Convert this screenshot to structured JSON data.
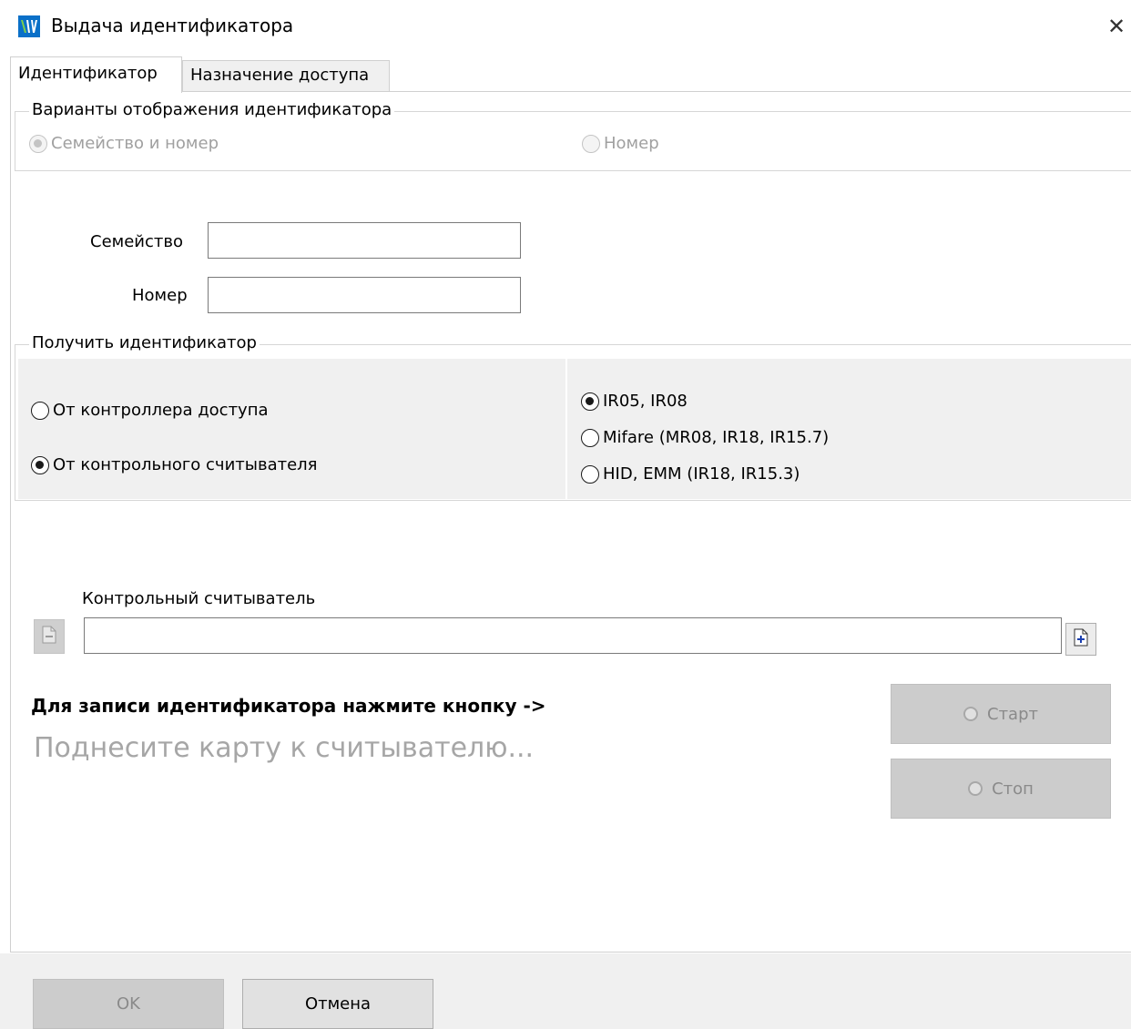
{
  "window": {
    "title": "Выдача идентификатора",
    "close_glyph": "✕",
    "icon": "app-logo-icon"
  },
  "tabs": [
    {
      "label": "Идентификатор",
      "active": true
    },
    {
      "label": "Назначение доступа",
      "active": false
    }
  ],
  "display_variants": {
    "legend": "Варианты отображения идентификатора",
    "options": [
      {
        "label": "Семейство и номер",
        "checked": true,
        "disabled": true
      },
      {
        "label": "Номер",
        "checked": false,
        "disabled": true
      }
    ]
  },
  "fields": {
    "family_label": "Семейство",
    "family_value": "",
    "number_label": "Номер",
    "number_value": ""
  },
  "get_identifier": {
    "legend": "Получить идентификатор",
    "source_options": [
      {
        "label": "От контроллера доступа",
        "checked": false
      },
      {
        "label": "От контрольного считывателя",
        "checked": true
      }
    ],
    "type_options": [
      {
        "label": "IR05, IR08",
        "checked": true
      },
      {
        "label": "Mifare (MR08, IR18, IR15.7)",
        "checked": false
      },
      {
        "label": "HID, EMM (IR18, IR15.3)",
        "checked": false
      }
    ]
  },
  "reader": {
    "label": "Контрольный считыватель",
    "value": "",
    "clear_icon": "document-clear-icon",
    "select_icon": "document-add-icon"
  },
  "write": {
    "instruction": "Для записи идентификатора нажмите кнопку ->",
    "hint": "Поднесите карту к считывателю...",
    "start_label": "Старт",
    "stop_label": "Стоп"
  },
  "footer": {
    "ok_label": "OK",
    "cancel_label": "Отмена"
  },
  "colors": {
    "accent_blue": "#0078d7",
    "logo_green": "#6bbf3a",
    "disabled_text": "#a0a0a0",
    "hint_text": "#a6a6a6"
  }
}
